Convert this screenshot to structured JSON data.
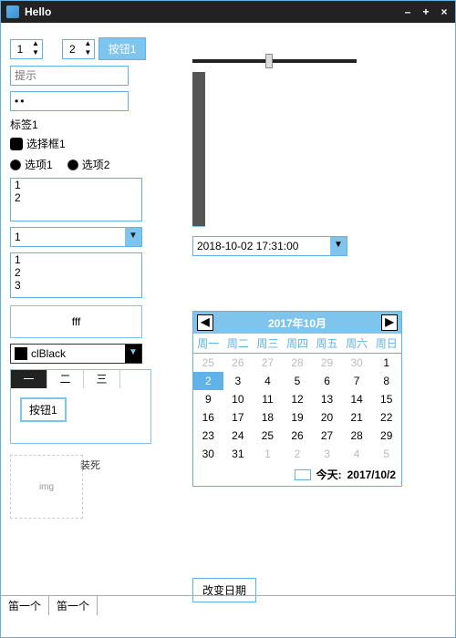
{
  "window": {
    "title": "Hello"
  },
  "spin1": "1",
  "spin2": "2",
  "button1": "按钮1",
  "input_placeholder": "提示",
  "password_value": "••",
  "label1": "标签1",
  "checkbox1": "选择框1",
  "radio1": "选项1",
  "radio2": "选项2",
  "listbox1": [
    "1",
    "2"
  ],
  "combo1_value": "1",
  "listbox2": [
    "1",
    "2",
    "3"
  ],
  "group_text": "fff",
  "color_name": "clBlack",
  "color_value": "#000000",
  "tabs": [
    "一",
    "二",
    "三"
  ],
  "tab_active": 0,
  "tab_button": "按钮1",
  "datetime_value": "2018-10-02 17:31:00",
  "calendar": {
    "title": "2017年10月",
    "dow": [
      "周一",
      "周二",
      "周三",
      "周四",
      "周五",
      "周六",
      "周日"
    ],
    "weeks": [
      [
        {
          "d": 25,
          "o": true
        },
        {
          "d": 26,
          "o": true
        },
        {
          "d": 27,
          "o": true
        },
        {
          "d": 28,
          "o": true
        },
        {
          "d": 29,
          "o": true
        },
        {
          "d": 30,
          "o": true
        },
        {
          "d": 1
        }
      ],
      [
        {
          "d": 2,
          "sel": true
        },
        {
          "d": 3
        },
        {
          "d": 4
        },
        {
          "d": 5
        },
        {
          "d": 6
        },
        {
          "d": 7
        },
        {
          "d": 8
        }
      ],
      [
        {
          "d": 9
        },
        {
          "d": 10
        },
        {
          "d": 11
        },
        {
          "d": 12
        },
        {
          "d": 13
        },
        {
          "d": 14
        },
        {
          "d": 15
        }
      ],
      [
        {
          "d": 16
        },
        {
          "d": 17
        },
        {
          "d": 18
        },
        {
          "d": 19
        },
        {
          "d": 20
        },
        {
          "d": 21
        },
        {
          "d": 22
        }
      ],
      [
        {
          "d": 23
        },
        {
          "d": 24
        },
        {
          "d": 25
        },
        {
          "d": 26
        },
        {
          "d": 27
        },
        {
          "d": 28
        },
        {
          "d": 29
        }
      ],
      [
        {
          "d": 30
        },
        {
          "d": 31
        },
        {
          "d": 1,
          "o": true
        },
        {
          "d": 2,
          "o": true
        },
        {
          "d": 3,
          "o": true
        },
        {
          "d": 4,
          "o": true
        },
        {
          "d": 5,
          "o": true
        }
      ]
    ],
    "today_label": "今天:",
    "today_value": "2017/10/2"
  },
  "change_date_btn": "改变日期",
  "status1": "笛一个",
  "status2": "笛一个"
}
